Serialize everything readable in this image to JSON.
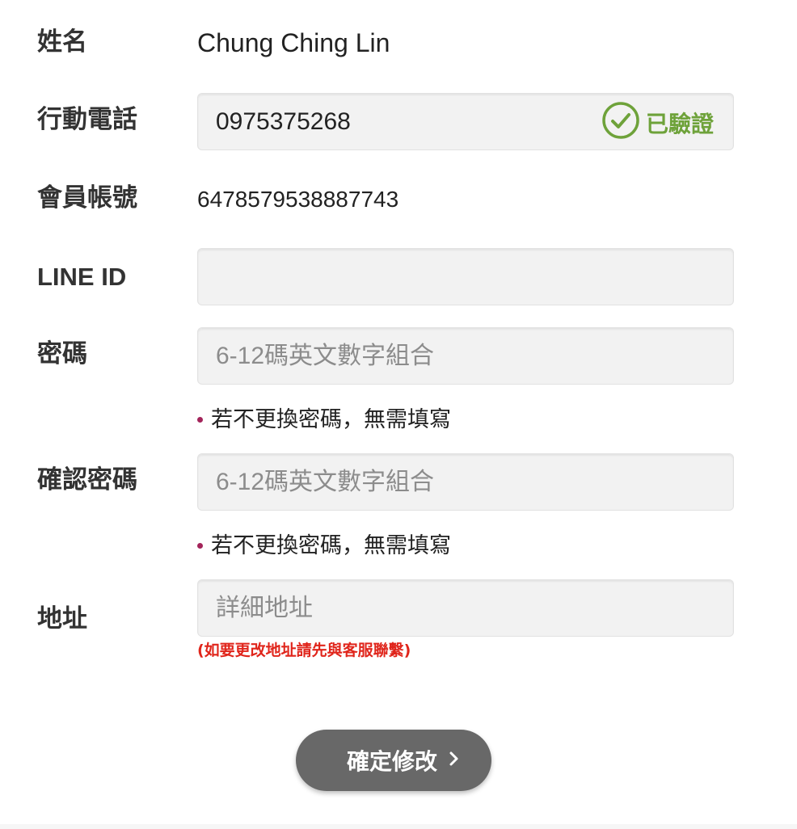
{
  "form": {
    "name": {
      "label": "姓名",
      "value": "Chung Ching Lin"
    },
    "phone": {
      "label": "行動電話",
      "value": "0975375268",
      "verified_label": "已驗證"
    },
    "account": {
      "label": "會員帳號",
      "value": "6478579538887743"
    },
    "line_id": {
      "label": "LINE ID",
      "value": "",
      "placeholder": ""
    },
    "password": {
      "label": "密碼",
      "placeholder": "6-12碼英文數字組合",
      "hint": "若不更換密碼，無需填寫"
    },
    "confirm_password": {
      "label": "確認密碼",
      "placeholder": "6-12碼英文數字組合",
      "hint": "若不更換密碼，無需填寫"
    },
    "address": {
      "label": "地址",
      "placeholder": "詳細地址",
      "notice": "(如要更改地址請先與客服聯繫)"
    }
  },
  "actions": {
    "submit_label": "確定修改",
    "submit_icon": "chevron-right-icon"
  },
  "colors": {
    "verified": "#6ea23a",
    "notice": "#e0251b",
    "hint_bullet": "#a3245a",
    "button_bg": "#686868",
    "field_bg": "#f2f2f2"
  }
}
